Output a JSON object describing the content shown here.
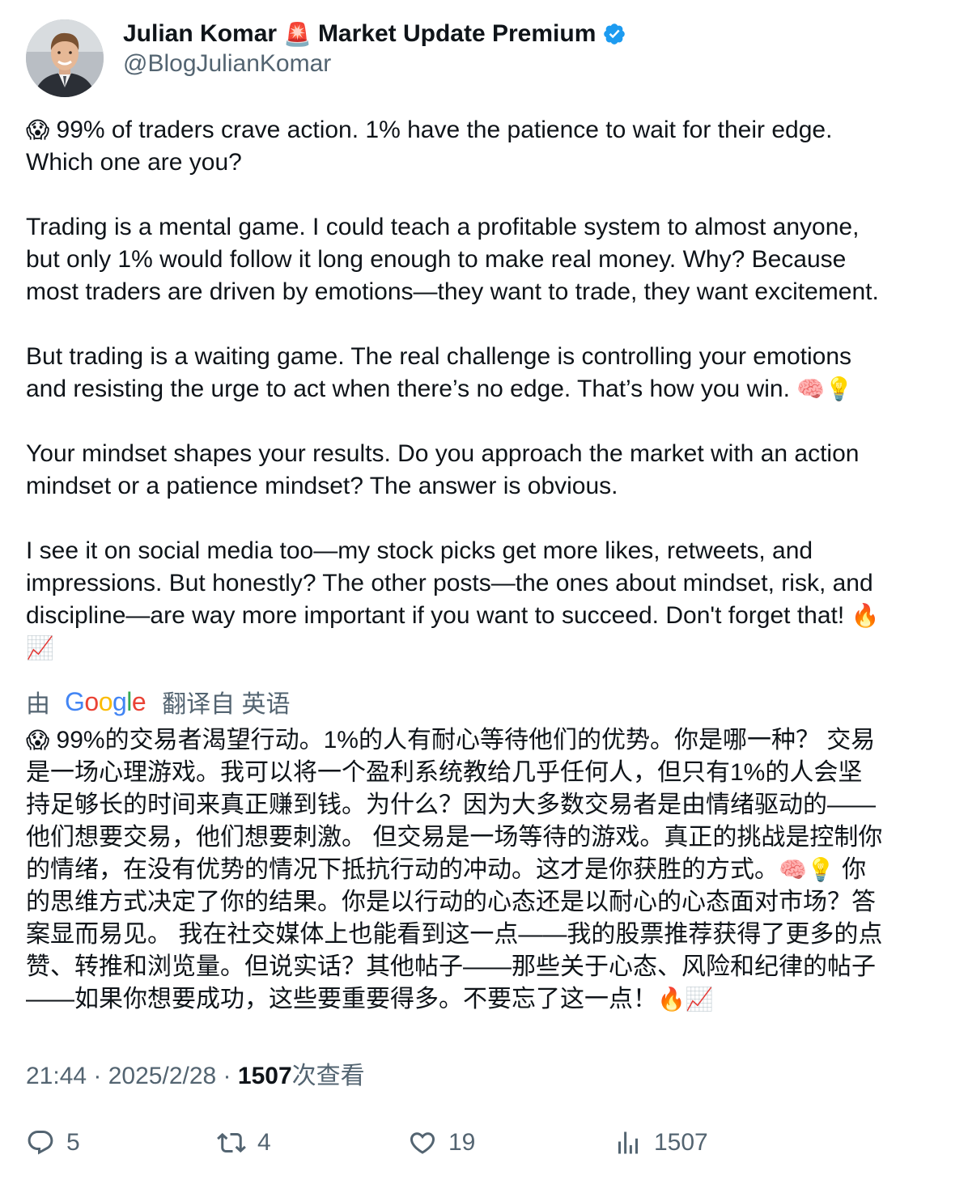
{
  "author": {
    "name": "Julian Komar",
    "badge_emoji": "🚨",
    "name_suffix": "Market Update Premium",
    "handle": "@BlogJulianKomar"
  },
  "tweet": {
    "lines": [
      {
        "emoji": "😱",
        "text": " 99% of traders crave action. 1% have the patience to wait for their edge."
      },
      {
        "text": "Which one are you?"
      },
      {
        "text": ""
      },
      {
        "text": "Trading is a mental game. I could teach a profitable system to almost anyone,"
      },
      {
        "text": "but only 1% would follow it long enough to make real money. Why? Because"
      },
      {
        "text": "most traders are driven by emotions—they want to trade, they want excitement."
      },
      {
        "text": ""
      },
      {
        "text": "But trading is a waiting game. The real challenge is controlling your emotions"
      },
      {
        "text": "and resisting the urge to act when there’s no edge. That’s how you win. ",
        "emoji_after": "🧠💡"
      },
      {
        "text": ""
      },
      {
        "text": "Your mindset shapes your results. Do you approach the market with an action"
      },
      {
        "text": "mindset or a patience mindset? The answer is obvious."
      },
      {
        "text": ""
      },
      {
        "text": "I see it on social media too—my stock picks get more likes, retweets, and"
      },
      {
        "text": "impressions. But honestly? The other posts—the ones about mindset, risk, and"
      },
      {
        "text": "discipline—are way more important if you want to succeed. Don't forget that! ",
        "emoji_after": "🔥"
      },
      {
        "emoji": "📈",
        "text": ""
      }
    ]
  },
  "translation": {
    "prefix": "由",
    "provider_letters": [
      "G",
      "o",
      "o",
      "g",
      "l",
      "e"
    ],
    "suffix": "翻译自 英语",
    "lines": [
      {
        "emoji": "😱",
        "text": " 99%的交易者渴望行动。1%的人有耐心等待他们的优势。你是哪一种？ 交易"
      },
      {
        "text": "是一场心理游戏。我可以将一个盈利系统教给几乎任何人，但只有1%的人会坚"
      },
      {
        "text": "持足够长的时间来真正赚到钱。为什么？因为大多数交易者是由情绪驱动的——"
      },
      {
        "text": "他们想要交易，他们想要刺激。 但交易是一场等待的游戏。真正的挑战是控制你"
      },
      {
        "text": "的情绪，在没有优势的情况下抵抗行动的冲动。这才是你获胜的方式。",
        "emoji_after": "🧠💡",
        "text_after": " 你"
      },
      {
        "text": "的思维方式决定了你的结果。你是以行动的心态还是以耐心的心态面对市场？答"
      },
      {
        "text": "案显而易见。 我在社交媒体上也能看到这一点——我的股票推荐获得了更多的点"
      },
      {
        "text": "赞、转推和浏览量。但说实话？其他帖子——那些关于心态、风险和纪律的帖子"
      },
      {
        "text": "——如果你想要成功，这些要重要得多。不要忘了这一点！",
        "emoji_after": "🔥📈"
      }
    ]
  },
  "meta": {
    "time": "21:44",
    "sep1": " · ",
    "date": "2025/2/28",
    "sep2": " · ",
    "views_count": "1507",
    "views_label": "次查看"
  },
  "actions": {
    "replies": "5",
    "retweets": "4",
    "likes": "19",
    "views": "1507"
  },
  "colors": {
    "text_primary": "#0f1419",
    "text_secondary": "#536471",
    "verified_blue": "#1d9bf0"
  }
}
